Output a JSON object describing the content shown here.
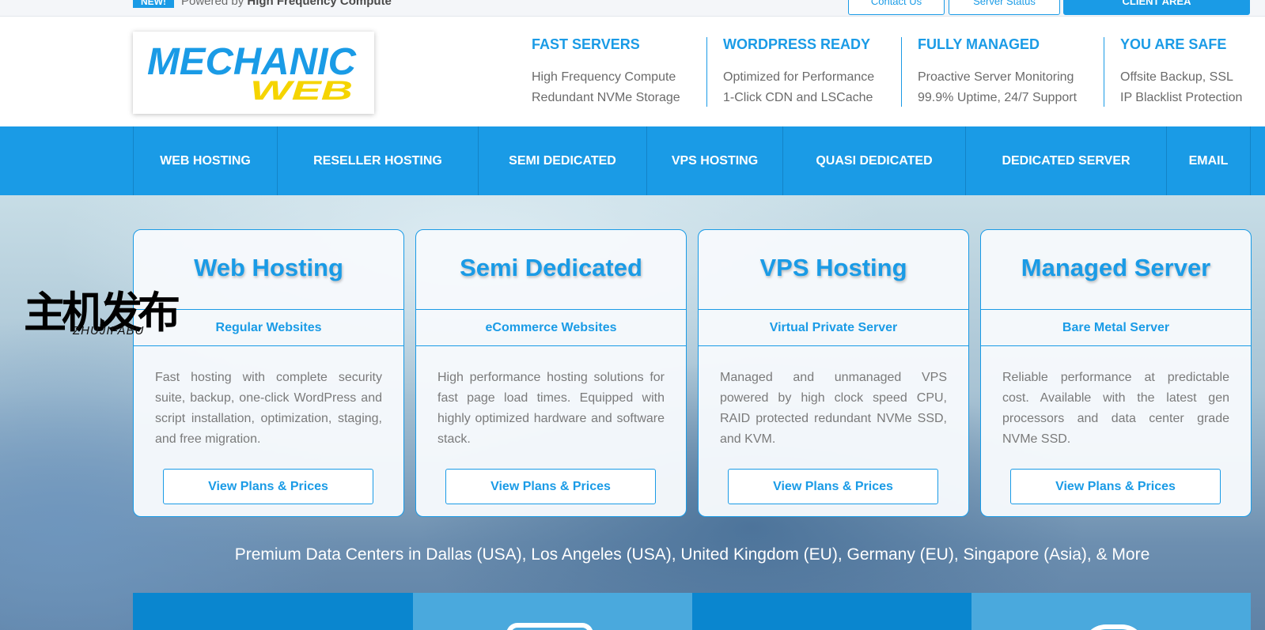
{
  "topbar": {
    "badge": "NEW!",
    "powered_prefix": "Powered by ",
    "powered_bold": "High Frequency Compute",
    "contact_label": "Contact Us",
    "status_label": "Server Status",
    "client_label": "CLIENT AREA"
  },
  "logo": {
    "line1": "MECHANIC",
    "line2": "WEB",
    "color_primary": "#1a9be6",
    "color_secondary": "#f5d400"
  },
  "features": [
    {
      "title": "FAST SERVERS",
      "line1": "High Frequency Compute",
      "line2": "Redundant NVMe Storage"
    },
    {
      "title": "WORDPRESS READY",
      "line1": "Optimized for Performance",
      "line2": "1-Click CDN and LSCache"
    },
    {
      "title": "FULLY MANAGED",
      "line1": "Proactive Server Monitoring",
      "line2": "99.9% Uptime, 24/7 Support"
    },
    {
      "title": "YOU ARE SAFE",
      "line1": "Offsite Backup, SSL",
      "line2": "IP Blacklist Protection"
    }
  ],
  "nav": [
    {
      "label": "WEB HOSTING"
    },
    {
      "label": "RESELLER HOSTING"
    },
    {
      "label": "SEMI DEDICATED"
    },
    {
      "label": "VPS HOSTING"
    },
    {
      "label": "QUASI DEDICATED"
    },
    {
      "label": "DEDICATED SERVER"
    },
    {
      "label": "EMAIL"
    }
  ],
  "cards": [
    {
      "title": "Web Hosting",
      "subtitle": "Regular Websites",
      "description": "Fast hosting with complete security suite, backup, one-click WordPress and script installation, optimization, staging, and free migration.",
      "button": "View Plans & Prices"
    },
    {
      "title": "Semi Dedicated",
      "subtitle": "eCommerce Websites",
      "description": "High performance hosting solutions for fast page load times. Equipped with highly optimized hardware and software stack.",
      "button": "View Plans & Prices"
    },
    {
      "title": "VPS Hosting",
      "subtitle": "Virtual Private Server",
      "description": "Managed and unmanaged VPS powered by high clock speed CPU, RAID protected redundant NVMe SSD, and KVM.",
      "button": "View Plans & Prices"
    },
    {
      "title": "Managed Server",
      "subtitle": "Bare Metal Server",
      "description": "Reliable performance at predictable cost. Available with the latest gen processors and data center grade NVMe SSD.",
      "button": "View Plans & Prices"
    }
  ],
  "datacenters": "Premium Data Centers in Dallas (USA), Los Angeles (USA), United Kingdom (EU), Germany (EU), Singapore (Asia), & More",
  "watermark": {
    "cn": "主机发布",
    "en": "ZHUJIFABU"
  },
  "colors": {
    "accent": "#1a9be6",
    "nav_divider": "#1383c7"
  }
}
